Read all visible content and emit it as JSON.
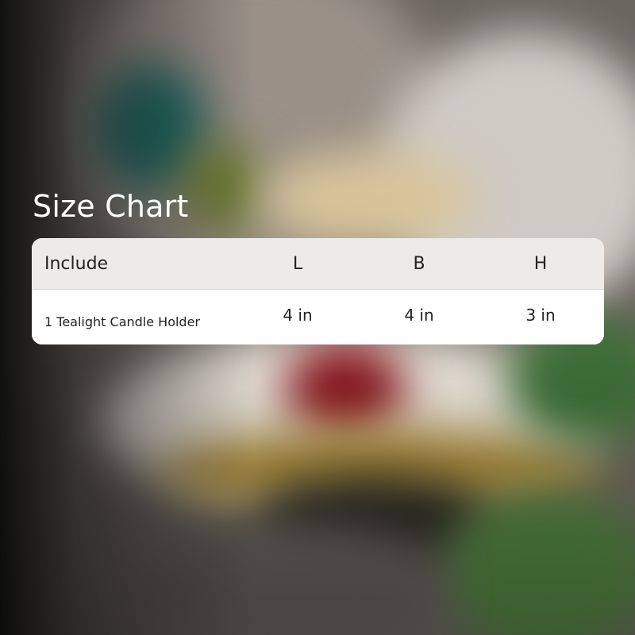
{
  "title": "Size Chart",
  "table": {
    "headers": [
      "Include",
      "L",
      "B",
      "H"
    ],
    "rows": [
      [
        "1 Tealight Candle Holder",
        "4 in",
        "4 in",
        "3 in"
      ]
    ]
  }
}
